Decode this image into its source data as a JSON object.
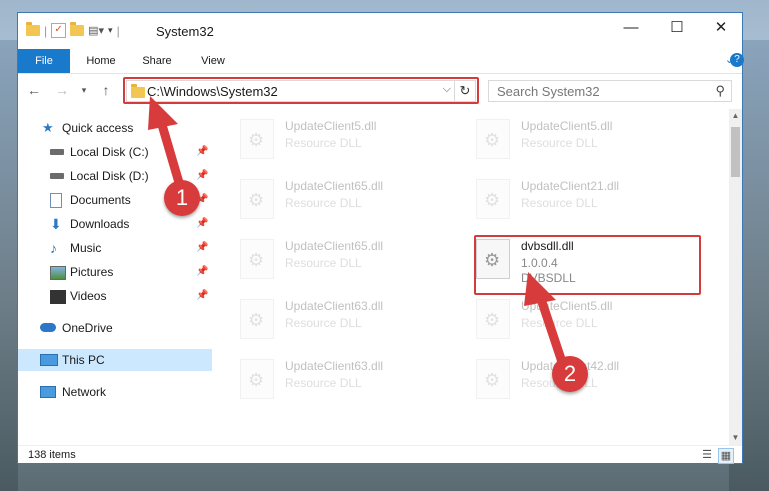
{
  "window": {
    "title": "System32",
    "minimize": "—",
    "maximize": "☐",
    "close": "✕"
  },
  "ribbon": {
    "tabs": [
      "File",
      "Home",
      "Share",
      "View"
    ]
  },
  "address": {
    "path": "C:\\Windows\\System32",
    "refresh": "↻"
  },
  "search": {
    "placeholder": "Search System32"
  },
  "nav": {
    "items": [
      {
        "label": "Quick access",
        "icon": "star-icon",
        "pinned": false
      },
      {
        "label": "Local Disk (C:)",
        "icon": "drive-icon",
        "pinned": true
      },
      {
        "label": "Local Disk (D:)",
        "icon": "drive-icon",
        "pinned": true
      },
      {
        "label": "Documents",
        "icon": "document-icon",
        "pinned": true
      },
      {
        "label": "Downloads",
        "icon": "download-icon",
        "pinned": true
      },
      {
        "label": "Music",
        "icon": "music-icon",
        "pinned": true
      },
      {
        "label": "Pictures",
        "icon": "pictures-icon",
        "pinned": true
      },
      {
        "label": "Videos",
        "icon": "video-icon",
        "pinned": true
      },
      {
        "label": "OneDrive",
        "icon": "cloud-icon",
        "pinned": false
      },
      {
        "label": "This PC",
        "icon": "computer-icon",
        "pinned": false,
        "selected": true
      },
      {
        "label": "Network",
        "icon": "network-icon",
        "pinned": false
      }
    ]
  },
  "files": [
    {
      "name": "UpdateClient5.dll",
      "type": "Resource DLL",
      "faded": true
    },
    {
      "name": "UpdateClient5.dll",
      "type": "Resource DLL",
      "faded": true
    },
    {
      "name": "UpdateClient65.dll",
      "type": "Resource DLL",
      "faded": true
    },
    {
      "name": "UpdateClient21.dll",
      "type": "Resource DLL",
      "faded": true
    },
    {
      "name": "UpdateClient65.dll",
      "type": "Resource DLL",
      "faded": true
    },
    {
      "name": "dvbsdll.dll",
      "type": "1.0.0.4",
      "desc": "DVBSDLL",
      "faded": false
    },
    {
      "name": "UpdateClient63.dll",
      "type": "Resource DLL",
      "faded": true
    },
    {
      "name": "UpdateClient5.dll",
      "type": "Resource DLL",
      "faded": true
    },
    {
      "name": "UpdateClient63.dll",
      "type": "Resource DLL",
      "faded": true
    },
    {
      "name": "UpdateClient42.dll",
      "type": "Resource DLL",
      "faded": true
    }
  ],
  "status": {
    "count": "138 items"
  },
  "callouts": [
    "1",
    "2"
  ],
  "colors": {
    "accent": "#1979ca",
    "highlight": "#d43c3c",
    "selected": "#cce8ff"
  }
}
